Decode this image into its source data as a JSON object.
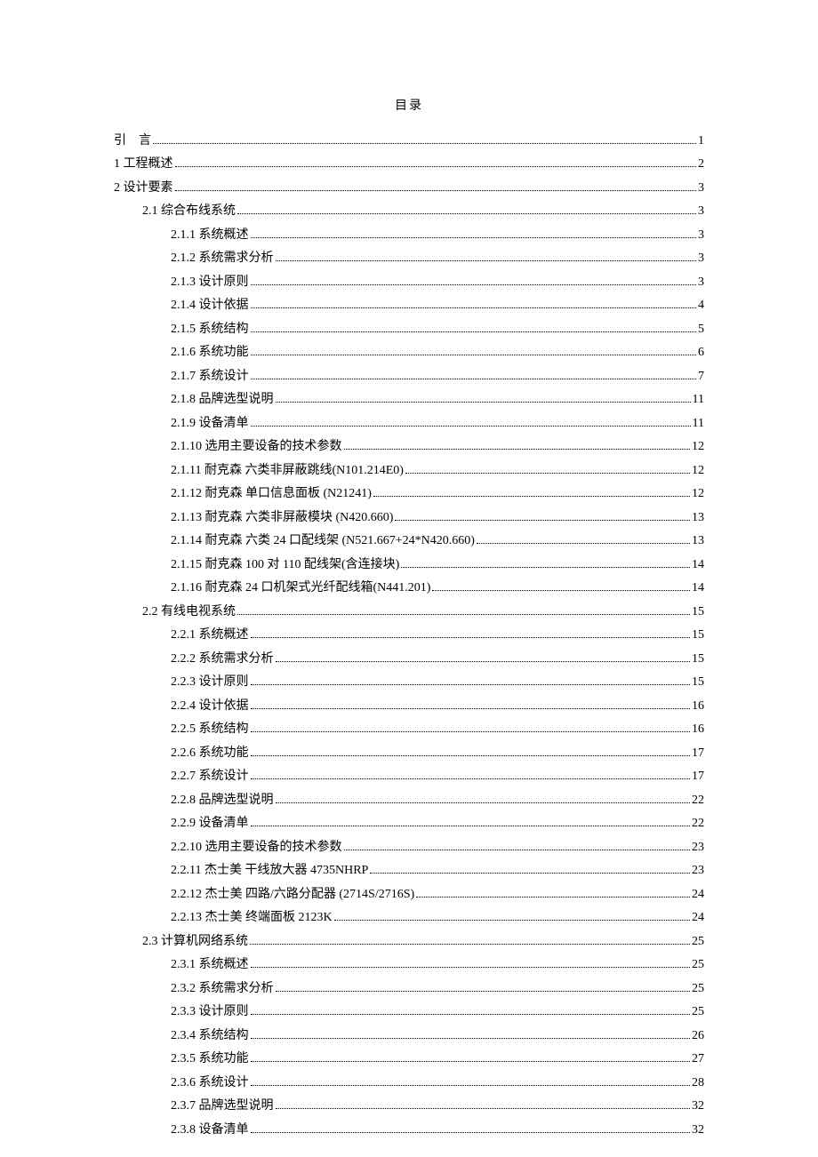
{
  "title": "目录",
  "entries": [
    {
      "indent": 0,
      "label": "引    言",
      "page": "1",
      "cls": ""
    },
    {
      "indent": 0,
      "label": "1 工程概述",
      "page": "2",
      "cls": ""
    },
    {
      "indent": 0,
      "label": "2 设计要素",
      "page": "3",
      "cls": ""
    },
    {
      "indent": 1,
      "label": "2.1 综合布线系统",
      "page": "3",
      "cls": ""
    },
    {
      "indent": 2,
      "label": "2.1.1 系统概述",
      "page": "3",
      "cls": ""
    },
    {
      "indent": 2,
      "label": "2.1.2 系统需求分析",
      "page": "3",
      "cls": ""
    },
    {
      "indent": 2,
      "label": "2.1.3 设计原则",
      "page": "3",
      "cls": ""
    },
    {
      "indent": 2,
      "label": "2.1.4 设计依据",
      "page": "4",
      "cls": ""
    },
    {
      "indent": 2,
      "label": "2.1.5 系统结构",
      "page": "5",
      "cls": ""
    },
    {
      "indent": 2,
      "label": "2.1.6 系统功能",
      "page": "6",
      "cls": ""
    },
    {
      "indent": 2,
      "label": "2.1.7 系统设计",
      "page": "7",
      "cls": ""
    },
    {
      "indent": 2,
      "label": "2.1.8 品牌选型说明",
      "page": "11",
      "cls": ""
    },
    {
      "indent": 2,
      "label": "2.1.9 设备清单",
      "page": "11",
      "cls": ""
    },
    {
      "indent": 2,
      "label": "2.1.10 选用主要设备的技术参数",
      "page": "12",
      "cls": ""
    },
    {
      "indent": 2,
      "label": "2.1.11 耐克森 六类非屏蔽跳线(N101.214E0)",
      "page": "12",
      "cls": ""
    },
    {
      "indent": 2,
      "label": "2.1.12 耐克森 单口信息面板 (N21241)",
      "page": "12",
      "cls": ""
    },
    {
      "indent": 2,
      "label": "2.1.13 耐克森 六类非屏蔽模块 (N420.660)",
      "page": "13",
      "cls": ""
    },
    {
      "indent": 2,
      "label": "2.1.14 耐克森 六类 24 口配线架 (N521.667+24*N420.660)",
      "page": "13",
      "cls": ""
    },
    {
      "indent": 2,
      "label": "2.1.15 耐克森 100 对 110 配线架(含连接块)",
      "page": "14",
      "cls": ""
    },
    {
      "indent": 2,
      "label": "2.1.16 耐克森 24 口机架式光纤配线箱(N441.201)",
      "page": "14",
      "cls": ""
    },
    {
      "indent": 1,
      "label": "2.2 有线电视系统",
      "page": "15",
      "cls": ""
    },
    {
      "indent": 2,
      "label": "2.2.1 系统概述",
      "page": "15",
      "cls": ""
    },
    {
      "indent": 2,
      "label": "2.2.2 系统需求分析",
      "page": "15",
      "cls": ""
    },
    {
      "indent": 2,
      "label": "2.2.3 设计原则",
      "page": "15",
      "cls": ""
    },
    {
      "indent": 2,
      "label": "2.2.4 设计依据",
      "page": "16",
      "cls": ""
    },
    {
      "indent": 2,
      "label": "2.2.5 系统结构",
      "page": "16",
      "cls": ""
    },
    {
      "indent": 2,
      "label": "2.2.6 系统功能",
      "page": "17",
      "cls": ""
    },
    {
      "indent": 2,
      "label": "2.2.7 系统设计",
      "page": "17",
      "cls": ""
    },
    {
      "indent": 2,
      "label": "2.2.8 品牌选型说明",
      "page": "22",
      "cls": ""
    },
    {
      "indent": 2,
      "label": "2.2.9 设备清单",
      "page": "22",
      "cls": ""
    },
    {
      "indent": 2,
      "label": "2.2.10 选用主要设备的技术参数",
      "page": "23",
      "cls": ""
    },
    {
      "indent": 2,
      "label": "2.2.11 杰士美 干线放大器 4735NHRP",
      "page": "23",
      "cls": ""
    },
    {
      "indent": 2,
      "label": "2.2.12 杰士美 四路/六路分配器 (2714S/2716S)",
      "page": "24",
      "cls": ""
    },
    {
      "indent": 2,
      "label": "2.2.13 杰士美 终端面板 2123K",
      "page": "24",
      "cls": ""
    },
    {
      "indent": 1,
      "label": "2.3 计算机网络系统",
      "page": "25",
      "cls": ""
    },
    {
      "indent": 2,
      "label": "2.3.1 系统概述",
      "page": "25",
      "cls": ""
    },
    {
      "indent": 2,
      "label": "2.3.2 系统需求分析",
      "page": "25",
      "cls": ""
    },
    {
      "indent": 2,
      "label": "2.3.3 设计原则",
      "page": "25",
      "cls": ""
    },
    {
      "indent": 2,
      "label": "2.3.4 系统结构",
      "page": "26",
      "cls": ""
    },
    {
      "indent": 2,
      "label": "2.3.5 系统功能",
      "page": "27",
      "cls": ""
    },
    {
      "indent": 2,
      "label": "2.3.6 系统设计",
      "page": "28",
      "cls": ""
    },
    {
      "indent": 2,
      "label": "2.3.7 品牌选型说明",
      "page": "32",
      "cls": ""
    },
    {
      "indent": 2,
      "label": "2.3.8 设备清单",
      "page": "32",
      "cls": ""
    }
  ]
}
